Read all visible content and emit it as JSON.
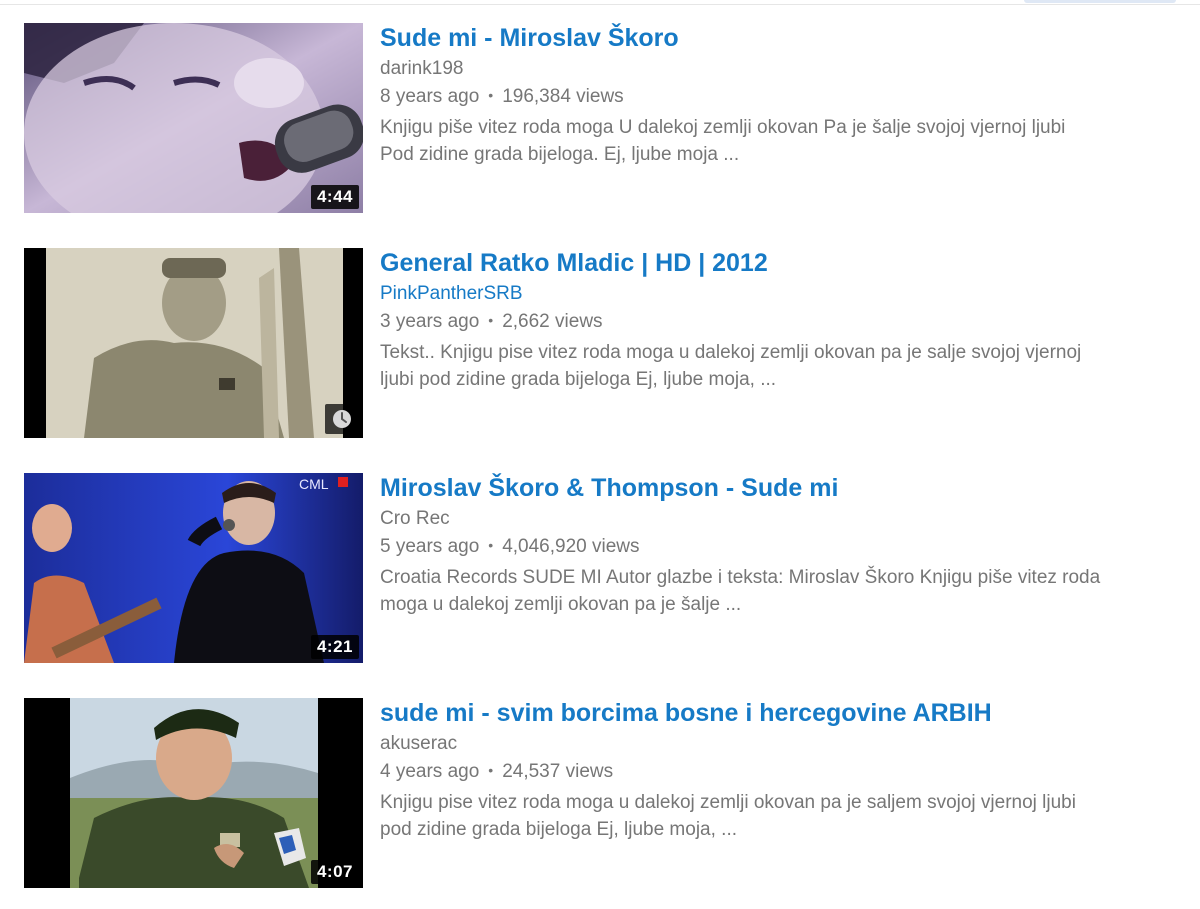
{
  "results": [
    {
      "title": "Sude mi - Miroslav Škoro",
      "channel": "darink198",
      "age": "8 years ago",
      "views": "196,384 views",
      "description_line1": "Knjigu piše vitez roda moga U dalekoj zemlji okovan Pa je šalje svojoj vjernoj ljubi",
      "description_line2": "Pod zidine grada bijeloga. Ej, ljube moja ...",
      "duration": "4:44"
    },
    {
      "title": "General Ratko Mladic | HD | 2012",
      "channel": "PinkPantherSRB",
      "age": "3 years ago",
      "views": "2,662 views",
      "description_line1": "Tekst.. Knjigu pise vitez roda moga u dalekoj zemlji okovan pa je salje svojoj vjernoj",
      "description_line2": "ljubi pod zidine grada bijeloga Ej, ljube moja, ...",
      "duration": ""
    },
    {
      "title": "Miroslav Škoro & Thompson - Sude mi",
      "channel": "Cro Rec",
      "age": "5 years ago",
      "views": "4,046,920 views",
      "description_line1": "Croatia Records SUDE MI Autor glazbe i teksta: Miroslav Škoro Knjigu piše vitez roda",
      "description_line2": "moga u dalekoj zemlji okovan pa je šalje ...",
      "duration": "4:21"
    },
    {
      "title": "sude mi - svim borcima bosne i hercegovine ARBIH",
      "channel": "akuserac",
      "age": "4 years ago",
      "views": "24,537 views",
      "description_line1": "Knjigu pise vitez roda moga u dalekoj zemlji okovan pa je saljem svojoj vjernoj ljubi",
      "description_line2": "pod zidine grada bijeloga Ej, ljube moja, ...",
      "duration": "4:07"
    }
  ],
  "thumb_overlay_text": "CML",
  "icons": {
    "watch_later": "clock-icon"
  },
  "colors": {
    "title_link": "#167ac6",
    "meta_text": "#767676",
    "duration_bg": "#000000"
  }
}
